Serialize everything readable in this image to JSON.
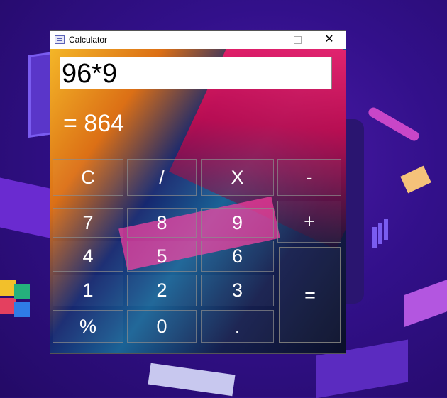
{
  "window": {
    "title": "Calculator",
    "icon": "calculator-app-icon",
    "controls": {
      "minimize_icon": "minimize-icon",
      "maximize_icon": "maximize-icon",
      "close_icon": "close-icon",
      "close_glyph": "✕"
    }
  },
  "display": {
    "expression": "96*9",
    "result": "= 864"
  },
  "keys": {
    "clear": "C",
    "divide": "/",
    "multiply": "X",
    "subtract": "-",
    "seven": "7",
    "eight": "8",
    "nine": "9",
    "add": "+",
    "four": "4",
    "five": "5",
    "six": "6",
    "one": "1",
    "two": "2",
    "three": "3",
    "equals": "=",
    "percent": "%",
    "zero": "0",
    "decimal": "."
  }
}
